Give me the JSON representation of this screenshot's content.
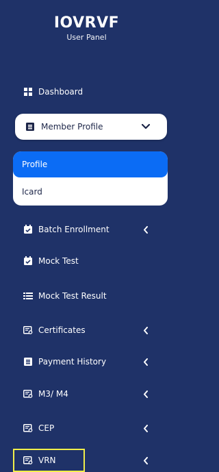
{
  "brand": {
    "title": "IOVRVF",
    "subtitle": "User Panel"
  },
  "colors": {
    "sidebar_bg": "#1f3268",
    "active_blue": "#0b6cf5",
    "highlight_yellow": "#f2f04a"
  },
  "nav": {
    "dashboard": {
      "label": "Dashboard",
      "icon": "grid-icon"
    },
    "member_profile": {
      "label": "Member Profile",
      "icon": "list-icon",
      "expanded": true,
      "submenu": [
        {
          "label": "Profile",
          "active": true
        },
        {
          "label": "Icard",
          "active": false
        }
      ]
    },
    "batch_enrollment": {
      "label": "Batch Enrollment",
      "icon": "calendar-check-icon"
    },
    "mock_test": {
      "label": "Mock Test",
      "icon": "calendar-check-icon"
    },
    "mock_test_result": {
      "label": "Mock Test Result",
      "icon": "list-icon"
    },
    "certificates": {
      "label": "Certificates",
      "icon": "certificate-icon"
    },
    "payment_history": {
      "label": "Payment History",
      "icon": "list-icon"
    },
    "m3_m4": {
      "label": "M3/ M4",
      "icon": "certificate-icon"
    },
    "cep": {
      "label": "CEP",
      "icon": "certificate-icon"
    },
    "vrn": {
      "label": "VRN",
      "icon": "certificate-icon",
      "highlighted": true
    }
  }
}
